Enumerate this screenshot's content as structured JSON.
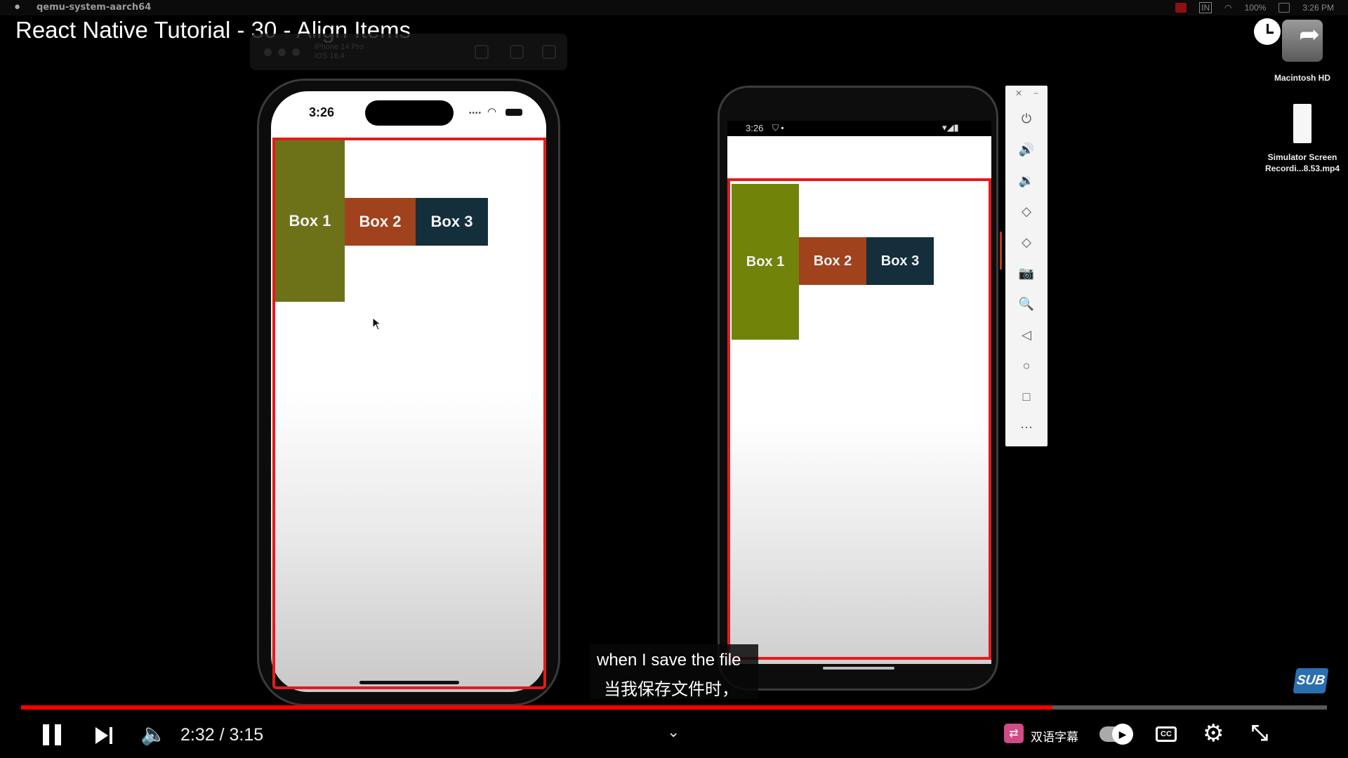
{
  "menubar": {
    "apple": "",
    "app_name": "qemu-system-aarch64",
    "battery": "100%",
    "clock": "3:26 PM",
    "input": "IN"
  },
  "video": {
    "title": "React Native Tutorial - 30 - Align Items",
    "time": "2:32 / 3:15",
    "progress": 0.79
  },
  "sim_toolbar": {
    "device": "iPhone 14 Pro",
    "os": "iOS 16.4"
  },
  "ios": {
    "time": "3:26",
    "boxes": [
      "Box 1",
      "Box 2",
      "Box 3"
    ]
  },
  "android": {
    "time": "3:26",
    "boxes": [
      "Box 1",
      "Box 2",
      "Box 3"
    ]
  },
  "emulator_controls": [
    "power-icon",
    "volume-up-icon",
    "volume-down-icon",
    "rotate-left-icon",
    "rotate-right-icon",
    "camera-icon",
    "zoom-icon",
    "back-icon",
    "home-icon",
    "overview-icon",
    "more-icon"
  ],
  "emulator_glyphs": [
    "⏻",
    "🔊",
    "🔉",
    "◇",
    "◇",
    "📷",
    "🔍",
    "◁",
    "○",
    "□",
    "⋯"
  ],
  "desktop": {
    "disk_label": "Macintosh HD",
    "file_label_1": "Simulator Screen",
    "file_label_2": "Recordi...8.53.mp4"
  },
  "captions": {
    "en": "when I save the file",
    "zh": "当我保存文件时，"
  },
  "controls": {
    "bilingual_label": "双语字幕",
    "cc": "CC",
    "sub_badge": "SUB"
  },
  "colors": {
    "box1_ios": "#6d7219",
    "box1_android": "#72830a",
    "box2": "#a0421c",
    "box3": "#152e3c",
    "border": "#e31b1b",
    "progress": "#ff0000"
  }
}
